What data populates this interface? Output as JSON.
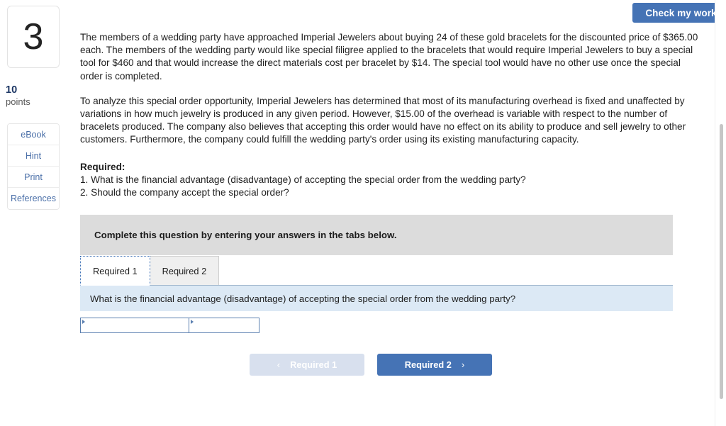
{
  "topbar": {
    "check_my_work_label": "Check my work"
  },
  "sidebar": {
    "question_number": "3",
    "points_value": "10",
    "points_label": "points",
    "resources": [
      {
        "label": "eBook"
      },
      {
        "label": "Hint"
      },
      {
        "label": "Print"
      },
      {
        "label": "References"
      }
    ]
  },
  "main": {
    "paragraph_1": "The members of a wedding party have approached Imperial Jewelers about buying 24 of these gold bracelets for the discounted price of $365.00 each. The members of the wedding party would like special filigree applied to the bracelets that would require Imperial Jewelers to buy a special tool for $460 and that would increase the direct materials cost per bracelet by $14. The special tool would have no other use once the special order is completed.",
    "paragraph_2": "To analyze this special order opportunity, Imperial Jewelers has determined that most of its manufacturing overhead is fixed and unaffected by variations in how much jewelry is produced in any given period. However, $15.00 of the overhead is variable with respect to the number of bracelets produced. The company also believes that accepting this order would have no effect on its ability to produce and sell jewelry to other customers. Furthermore, the company could fulfill the wedding party's order using its existing manufacturing capacity.",
    "required_heading": "Required:",
    "required_item_1": "1. What is the financial advantage (disadvantage) of accepting the special order from the wedding party?",
    "required_item_2": "2. Should the company accept the special order?"
  },
  "answer_panel": {
    "instruction": "Complete this question by entering your answers in the tabs below.",
    "tabs": [
      {
        "label": "Required 1",
        "active": true
      },
      {
        "label": "Required 2",
        "active": false
      }
    ],
    "question_prompt": "What is the financial advantage (disadvantage) of accepting the special order from the wedding party?",
    "answer_cells": [
      {
        "value": "",
        "placeholder": ""
      },
      {
        "value": "",
        "placeholder": ""
      }
    ]
  },
  "nav": {
    "prev_label": "Required 1",
    "prev_chevron": "‹",
    "next_label": "Required 2",
    "next_chevron": "›"
  },
  "colors": {
    "accent_blue": "#4573b5",
    "disabled_blue": "#d8e0ee",
    "instruction_gray": "#dcdcdc",
    "prompt_blue": "#dce9f5",
    "link_blue": "#4a6fa8",
    "points_navy": "#1c3664",
    "input_border": "#5a7fb0"
  }
}
